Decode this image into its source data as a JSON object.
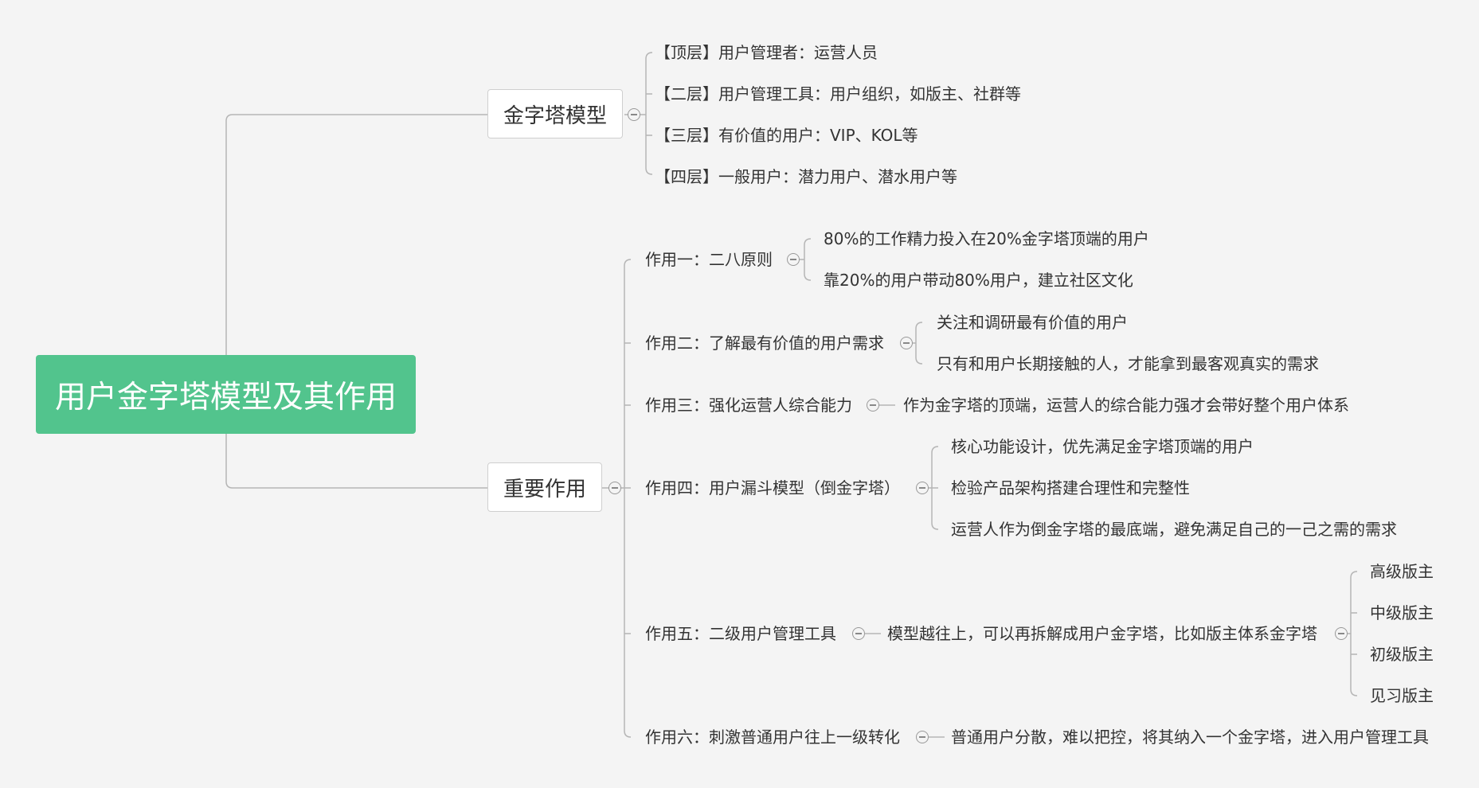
{
  "root": {
    "label": "用户金字塔模型及其作用"
  },
  "branches": {
    "model": {
      "label": "金字塔模型",
      "items": [
        "【顶层】用户管理者：运营人员",
        "【二层】用户管理工具：用户组织，如版主、社群等",
        "【三层】有价值的用户：VIP、KOL等",
        "【四层】一般用户：潜力用户、潜水用户等"
      ]
    },
    "roles": {
      "label": "重要作用",
      "items": [
        {
          "label": "作用一：二八原则",
          "children": [
            "80%的工作精力投入在20%金字塔顶端的用户",
            "靠20%的用户带动80%用户，建立社区文化"
          ]
        },
        {
          "label": "作用二：了解最有价值的用户需求",
          "children": [
            "关注和调研最有价值的用户",
            "只有和用户长期接触的人，才能拿到最客观真实的需求"
          ]
        },
        {
          "label": "作用三：强化运营人综合能力",
          "children": [
            "作为金字塔的顶端，运营人的综合能力强才会带好整个用户体系"
          ]
        },
        {
          "label": "作用四：用户漏斗模型（倒金字塔）",
          "children": [
            "核心功能设计，优先满足金字塔顶端的用户",
            "检验产品架构搭建合理性和完整性",
            "运营人作为倒金字塔的最底端，避免满足自己的一己之需的需求"
          ]
        },
        {
          "label": "作用五：二级用户管理工具",
          "child": "模型越往上，可以再拆解成用户金字塔，比如版主体系金字塔",
          "grandchildren": [
            "高级版主",
            "中级版主",
            "初级版主",
            "见习版主"
          ]
        },
        {
          "label": "作用六：刺激普通用户往上一级转化",
          "children": [
            "普通用户分散，难以把控，将其纳入一个金字塔，进入用户管理工具"
          ]
        }
      ]
    }
  },
  "colors": {
    "root": "#52c48d",
    "line": "#b5b5b5",
    "background": "#f4f4f4"
  },
  "icons": {
    "collapse": "collapse-minus-icon"
  }
}
